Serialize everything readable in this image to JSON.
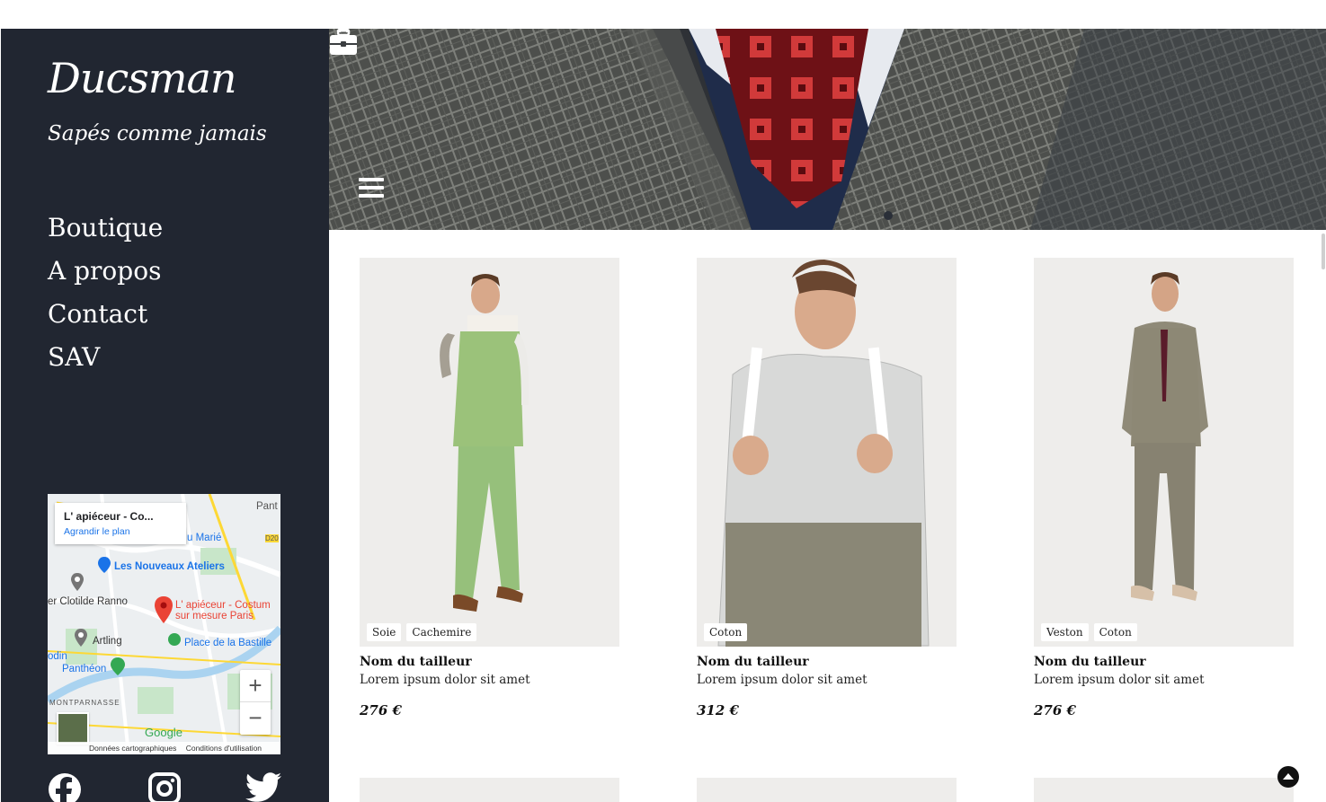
{
  "sidebar": {
    "brand": "Ducsman",
    "tagline": "Sapés comme jamais",
    "nav": [
      "Boutique",
      "A propos",
      "Contact",
      "SAV"
    ],
    "map": {
      "place_title": "L' apiéceur - Co...",
      "enlarge_link": "Agrandir le plan",
      "labels": {
        "marie": "u Marié",
        "panth": "Pant",
        "d20": "D20",
        "ateliers": "Les Nouveaux Ateliers",
        "clotilde": "er Clotilde Ranno",
        "apieceur1": "L' apiéceur - Costum",
        "apieceur2": "sur mesure Paris",
        "artling": "Artling",
        "bastille": "Place de la Bastille",
        "odin": "odin",
        "pantheon": "Panthéon",
        "montparnasse": "MONTPARNASSE"
      },
      "google": "Google",
      "attribution_data": "Données cartographiques",
      "attribution_terms": "Conditions d'utilisation",
      "zoom_in": "+",
      "zoom_out": "−"
    },
    "social": [
      "facebook-icon",
      "instagram-icon",
      "twitter-icon"
    ]
  },
  "header": {
    "menu_icon": "hamburger-icon",
    "bag_icon": "briefcase-icon"
  },
  "products": [
    {
      "name": "Nom du tailleur",
      "description": "Lorem ipsum dolor sit amet",
      "price": "276 €",
      "tags": [
        "Soie",
        "Cachemire"
      ]
    },
    {
      "name": "Nom du tailleur",
      "description": "Lorem ipsum dolor sit amet",
      "price": "312 €",
      "tags": [
        "Coton"
      ]
    },
    {
      "name": "Nom du tailleur",
      "description": "Lorem ipsum dolor sit amet",
      "price": "276 €",
      "tags": [
        "Veston",
        "Coton"
      ]
    }
  ],
  "colors": {
    "sidebar_bg": "#212631",
    "image_bg": "#eeedeb",
    "accent_red": "#c0282e"
  }
}
